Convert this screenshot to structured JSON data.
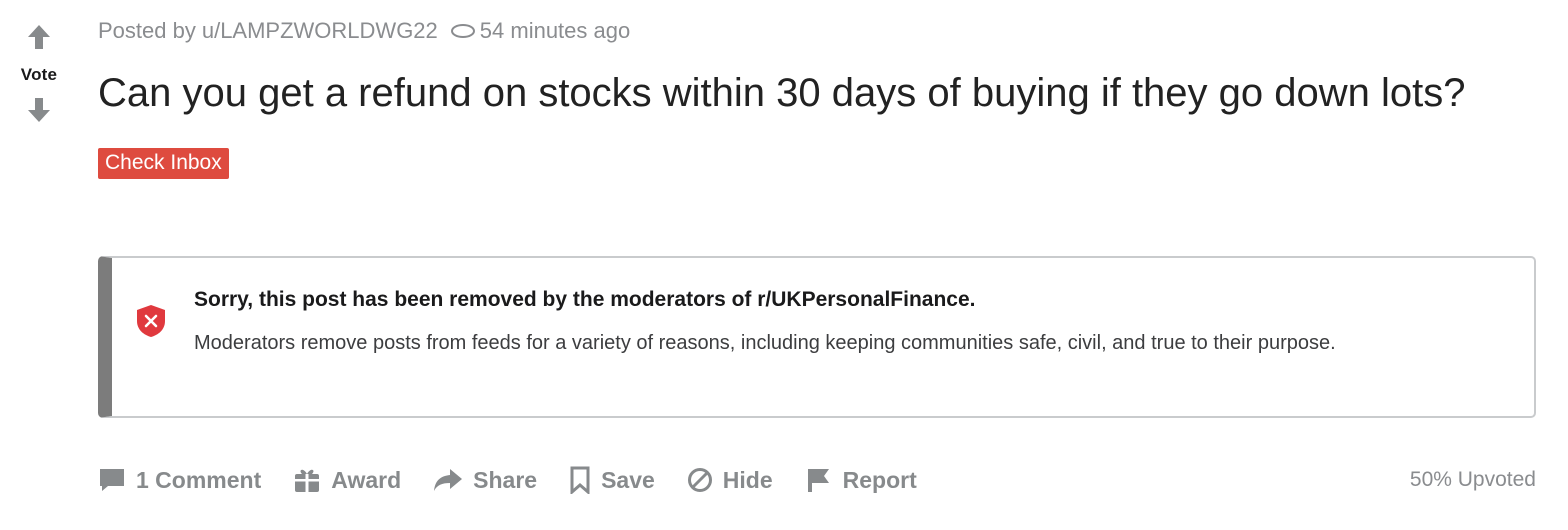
{
  "vote": {
    "label": "Vote"
  },
  "post": {
    "posted_by_prefix": "Posted by",
    "author": "u/LAMPZWORLDWG22",
    "time": "54 minutes ago",
    "title": "Can you get a refund on stocks within 30 days of buying if they go down lots?",
    "flair": "Check Inbox"
  },
  "removed": {
    "title": "Sorry, this post has been removed by the moderators of r/UKPersonalFinance.",
    "text": "Moderators remove posts from feeds for a variety of reasons, including keeping communities safe, civil, and true to their purpose."
  },
  "actions": {
    "comment": "1 Comment",
    "award": "Award",
    "share": "Share",
    "save": "Save",
    "hide": "Hide",
    "report": "Report",
    "upvoted": "50% Upvoted"
  },
  "icons": {
    "upvote": "arrow-up-icon",
    "downvote": "arrow-down-icon",
    "watch": "eye-icon",
    "shield": "shield-x-icon",
    "comment": "comment-icon",
    "award": "gift-icon",
    "share": "share-arrow-icon",
    "save": "bookmark-icon",
    "hide": "circle-slash-icon",
    "report": "flag-icon"
  },
  "colors": {
    "flair_bg": "#de4b3f",
    "shield": "#e0393e",
    "muted_text": "#878a8c",
    "removed_border": "#7c7c7c"
  }
}
